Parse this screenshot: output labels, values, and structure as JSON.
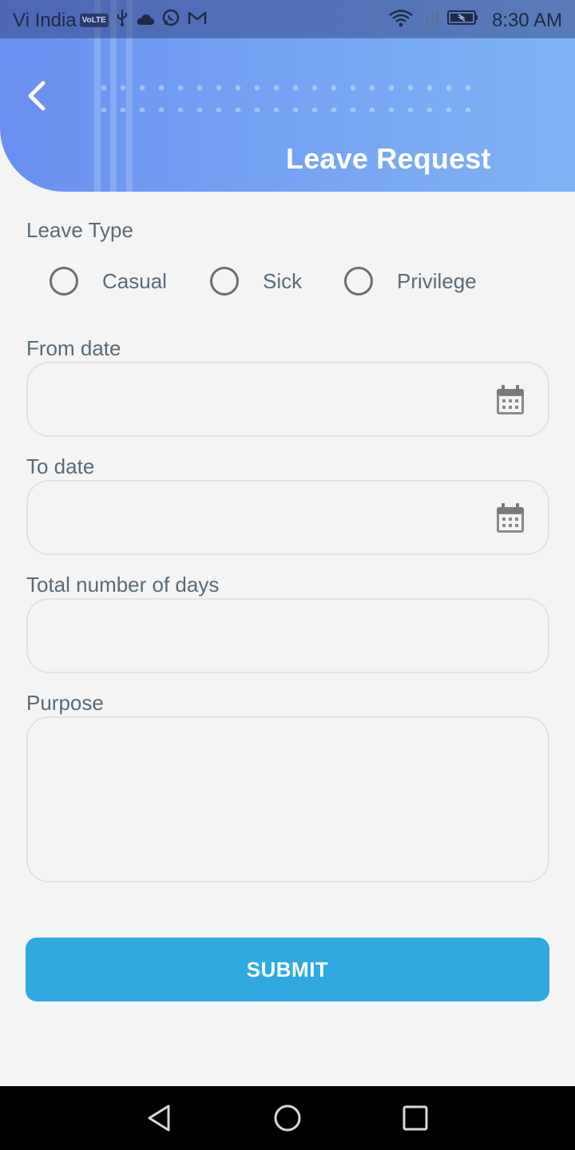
{
  "status_bar": {
    "carrier": "Vi India",
    "volte": "VoLTE",
    "time": "8:30 AM",
    "icons": [
      "usb-icon",
      "cloud-icon",
      "whatsapp-icon",
      "gmail-icon",
      "wifi-icon",
      "signal-icon",
      "battery-icon"
    ]
  },
  "header": {
    "title": "Leave Request",
    "back_icon": "back-arrow-icon"
  },
  "form": {
    "leave_type_label": "Leave Type",
    "leave_types": [
      "Casual",
      "Sick",
      "Privilege"
    ],
    "from_date_label": "From date",
    "from_date_value": "",
    "to_date_label": "To date",
    "to_date_value": "",
    "total_days_label": "Total number of days",
    "total_days_value": "",
    "purpose_label": "Purpose",
    "purpose_value": "",
    "submit_label": "SUBMIT"
  },
  "colors": {
    "header_gradient_start": "#6a8ff0",
    "header_gradient_end": "#80b3f5",
    "submit": "#2eaae0",
    "label_text": "#5a6b78",
    "background": "#f4f4f4"
  },
  "nav_bar": {
    "icons": [
      "back-triangle-icon",
      "home-circle-icon",
      "recents-square-icon"
    ]
  }
}
